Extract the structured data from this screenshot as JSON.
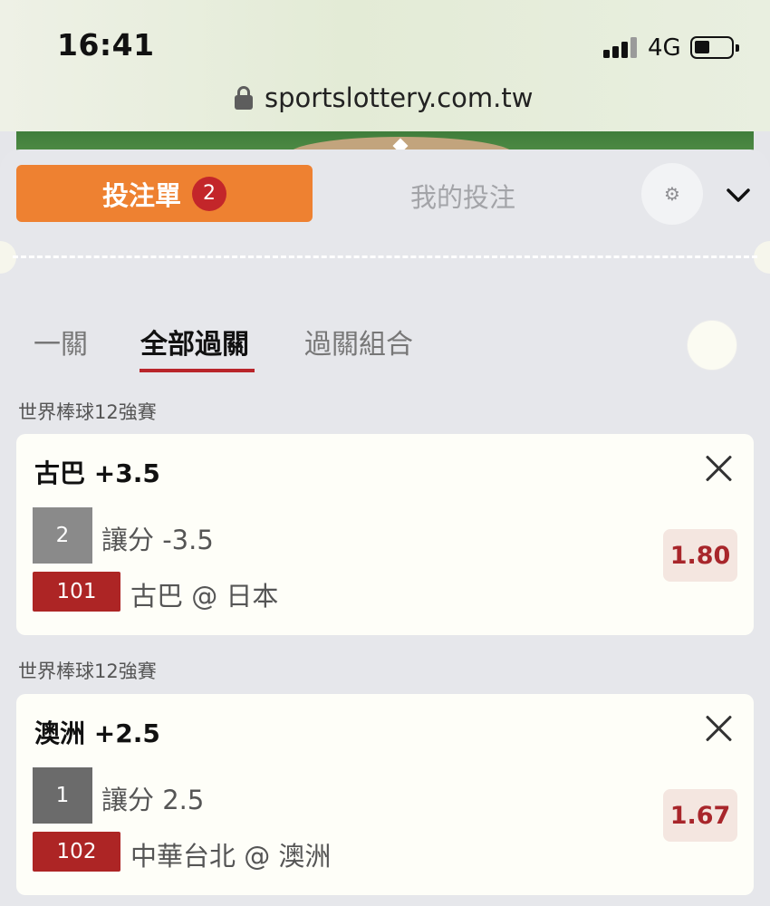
{
  "status_bar": {
    "time": "16:41",
    "network": "4G"
  },
  "browser": {
    "url": "sportslottery.com.tw"
  },
  "header": {
    "betslip_label": "投注單",
    "betslip_count": "2",
    "mybets_label": "我的投注"
  },
  "tabs": [
    {
      "label": "一關"
    },
    {
      "label": "全部過關"
    },
    {
      "label": "過關組合"
    }
  ],
  "bets": [
    {
      "league": "世界棒球12強賽",
      "title": "古巴 +3.5",
      "selection": "2",
      "selection_color": "#8a8a8a",
      "bet_type": "讓分 -3.5",
      "game_no": "101",
      "match": "古巴 @ 日本",
      "odds": "1.80"
    },
    {
      "league": "世界棒球12強賽",
      "title": "澳洲 +2.5",
      "selection": "1",
      "selection_color": "#6b6b6b",
      "bet_type": "讓分 2.5",
      "game_no": "102",
      "match": "中華台北 @ 澳洲",
      "odds": "1.67"
    }
  ],
  "colors": {
    "accent": "#ee8131",
    "badge": "#c3262a",
    "odds_text": "#a8262b",
    "game_no_bg": "#ad2525"
  }
}
